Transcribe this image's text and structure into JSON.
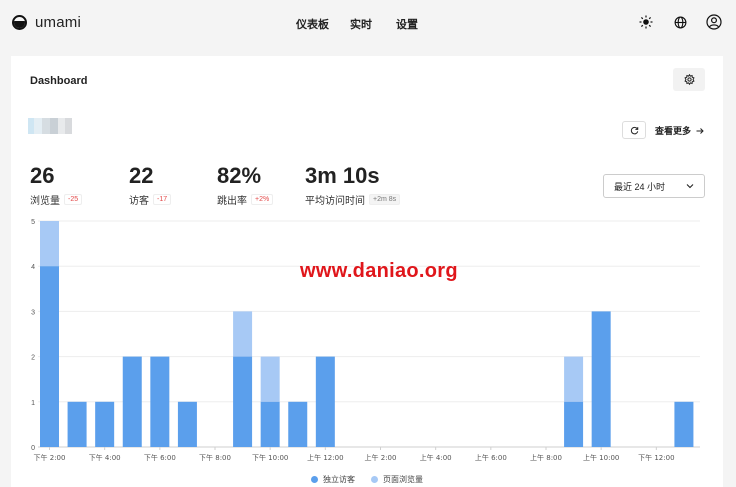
{
  "app": {
    "name": "umami"
  },
  "nav": {
    "items": [
      "仪表板",
      "实时",
      "设置"
    ]
  },
  "icons": {
    "theme": "sun-icon",
    "language": "globe-icon",
    "profile": "user-icon",
    "settings": "gear-icon",
    "refresh": "refresh-icon",
    "arrow": "arrow-right-icon",
    "chevron": "chevron-down-icon"
  },
  "card": {
    "title": "Dashboard",
    "more_label": "查看更多"
  },
  "metrics": [
    {
      "value": "26",
      "label": "浏览量",
      "change": "-25",
      "change_style": "red"
    },
    {
      "value": "22",
      "label": "访客",
      "change": "-17",
      "change_style": "red"
    },
    {
      "value": "82%",
      "label": "跳出率",
      "change": "+2%",
      "change_style": "red"
    },
    {
      "value": "3m 10s",
      "label": "平均访问时间",
      "change": "+2m 8s",
      "change_style": "grey"
    }
  ],
  "range": {
    "selected": "最近 24 小时"
  },
  "watermark": "www.daniao.org",
  "colors": {
    "visitors": "#5b9fec",
    "views": "#a7c9f5",
    "accent_red": "#e34a4a"
  },
  "chart_data": {
    "type": "bar",
    "stacked": true,
    "categories": [
      "下午 2:00",
      "下午 3:00",
      "下午 4:00",
      "下午 5:00",
      "下午 6:00",
      "下午 7:00",
      "下午 8:00",
      "下午 9:00",
      "下午 10:00",
      "下午 11:00",
      "上午 12:00",
      "上午 1:00",
      "上午 2:00",
      "上午 3:00",
      "上午 4:00",
      "上午 5:00",
      "上午 6:00",
      "上午 7:00",
      "上午 8:00",
      "上午 9:00",
      "上午 10:00",
      "上午 11:00",
      "下午 12:00",
      "下午 1:00"
    ],
    "tick_labels": [
      "下午 2:00",
      "下午 4:00",
      "下午 6:00",
      "下午 8:00",
      "下午 10:00",
      "上午 12:00",
      "上午 2:00",
      "上午 4:00",
      "上午 6:00",
      "上午 8:00",
      "上午 10:00",
      "下午 12:00"
    ],
    "tick_indices": [
      0,
      2,
      4,
      6,
      8,
      10,
      12,
      14,
      16,
      18,
      20,
      22
    ],
    "series": [
      {
        "name": "独立访客",
        "values": [
          4,
          1,
          1,
          2,
          2,
          1,
          0,
          2,
          1,
          1,
          2,
          0,
          0,
          0,
          0,
          0,
          0,
          0,
          0,
          1,
          3,
          0,
          0,
          1
        ]
      },
      {
        "name": "页面浏览量",
        "values": [
          5,
          1,
          1,
          2,
          2,
          1,
          0,
          3,
          2,
          1,
          2,
          0,
          0,
          0,
          0,
          0,
          0,
          0,
          0,
          2,
          3,
          0,
          0,
          1
        ]
      }
    ],
    "ylim": [
      0,
      5
    ],
    "yticks": [
      0,
      1,
      2,
      3,
      4,
      5
    ],
    "grid": true,
    "legend_position": "bottom-center"
  }
}
